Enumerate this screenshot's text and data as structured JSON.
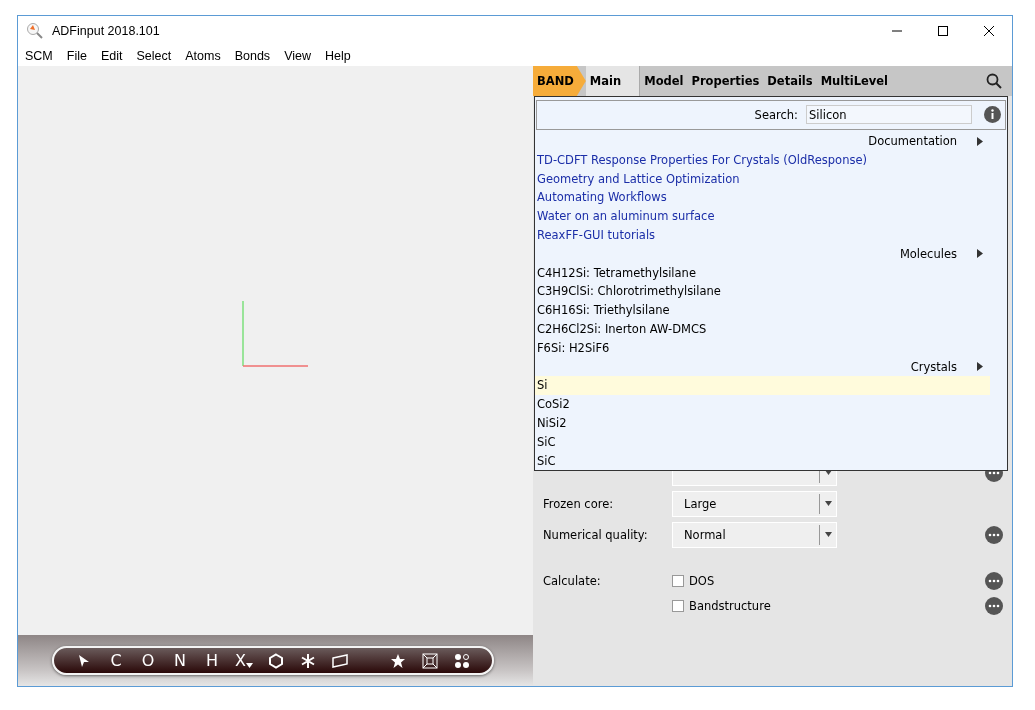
{
  "window": {
    "title": "ADFinput 2018.101"
  },
  "menu": [
    "SCM",
    "File",
    "Edit",
    "Select",
    "Atoms",
    "Bonds",
    "View",
    "Help"
  ],
  "tabs": [
    {
      "label": "BAND",
      "kind": "module",
      "selected": false
    },
    {
      "label": "Main",
      "kind": "tab",
      "selected": true
    },
    {
      "label": "Model",
      "kind": "tab",
      "selected": false
    },
    {
      "label": "Properties",
      "kind": "tab",
      "selected": false
    },
    {
      "label": "Details",
      "kind": "tab",
      "selected": false
    },
    {
      "label": "MultiLevel",
      "kind": "tab",
      "selected": false
    }
  ],
  "search": {
    "label": "Search:",
    "value": "Silicon"
  },
  "results": [
    {
      "heading": "Documentation",
      "items": [
        {
          "text": "TD-CDFT Response Properties For Crystals (OldResponse)",
          "kind": "link",
          "selected": false
        },
        {
          "text": "Geometry and Lattice Optimization",
          "kind": "link",
          "selected": false
        },
        {
          "text": "Automating Workflows",
          "kind": "link",
          "selected": false
        },
        {
          "text": "Water on an aluminum surface",
          "kind": "link",
          "selected": false
        },
        {
          "text": "ReaxFF-GUI tutorials",
          "kind": "link",
          "selected": false
        }
      ]
    },
    {
      "heading": "Molecules",
      "items": [
        {
          "text": "C4H12Si: Tetramethylsilane",
          "kind": "plain",
          "selected": false
        },
        {
          "text": "C3H9ClSi: Chlorotrimethylsilane",
          "kind": "plain",
          "selected": false
        },
        {
          "text": "C6H16Si: Triethylsilane",
          "kind": "plain",
          "selected": false
        },
        {
          "text": "C2H6Cl2Si: Inerton AW-DMCS",
          "kind": "plain",
          "selected": false
        },
        {
          "text": "F6Si: H2SiF6",
          "kind": "plain",
          "selected": false
        }
      ]
    },
    {
      "heading": "Crystals",
      "items": [
        {
          "text": "Si",
          "kind": "plain",
          "selected": true
        },
        {
          "text": "CoSi2",
          "kind": "plain",
          "selected": false
        },
        {
          "text": "NiSi2",
          "kind": "plain",
          "selected": false
        },
        {
          "text": "SiC",
          "kind": "plain",
          "selected": false
        },
        {
          "text": "SiC",
          "kind": "plain",
          "selected": false
        }
      ]
    }
  ],
  "form": [
    {
      "kind": "covered",
      "more": true
    },
    {
      "kind": "field",
      "label": "Frozen core:",
      "value": "Large",
      "more": false
    },
    {
      "kind": "field",
      "label": "Numerical quality:",
      "value": "Normal",
      "more": true
    }
  ],
  "calculate": {
    "label": "Calculate:",
    "options": [
      {
        "label": "DOS",
        "checked": false
      },
      {
        "label": "Bandstructure",
        "checked": false
      }
    ]
  },
  "toolbar": [
    {
      "label": "C",
      "kind": "element"
    },
    {
      "label": "O",
      "kind": "element"
    },
    {
      "label": "N",
      "kind": "element"
    },
    {
      "label": "H",
      "kind": "element"
    },
    {
      "label": "X",
      "kind": "menu"
    }
  ]
}
